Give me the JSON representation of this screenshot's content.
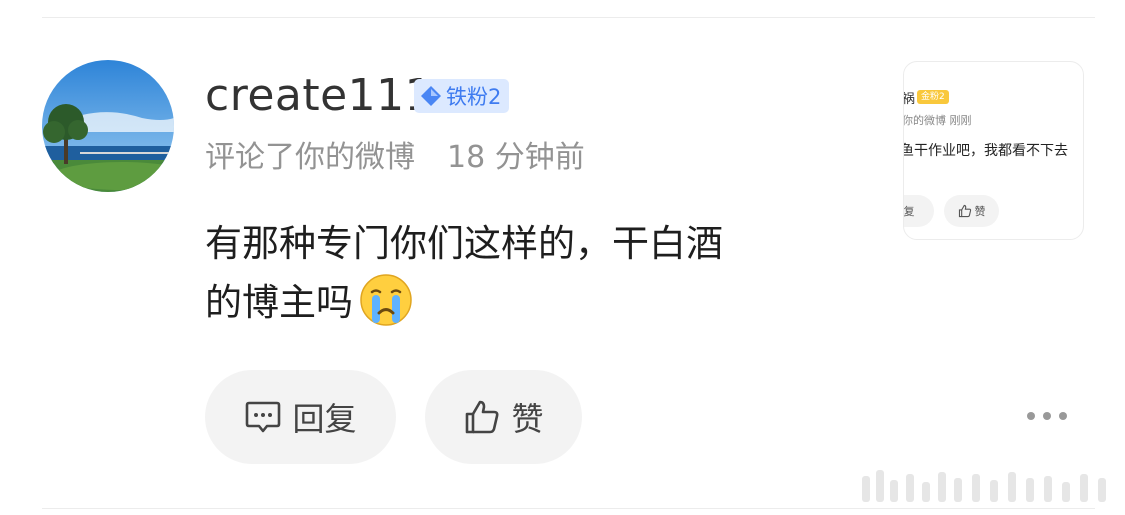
{
  "user": {
    "name": "create111",
    "badge_label": "铁粉2",
    "badge_color": "#3e7bf0"
  },
  "meta": {
    "action": "评论了你的微博",
    "time": "18 分钟前"
  },
  "comment": {
    "text_line1": "有那种专门你们这样的，干白酒",
    "text_line2": "的博主吗",
    "emoji": "crying-face-emoji"
  },
  "actions": {
    "reply_label": "回复",
    "like_label": "赞",
    "more_icon": "ellipsis-icon"
  },
  "thumbnail": {
    "name_fragment": "祸",
    "level_label": "金粉2",
    "meta_fragment": "你的微博  刚刚",
    "body_fragment": "鱼干作业吧，我都看不下去",
    "reply_label": "复",
    "like_label": "赞"
  }
}
